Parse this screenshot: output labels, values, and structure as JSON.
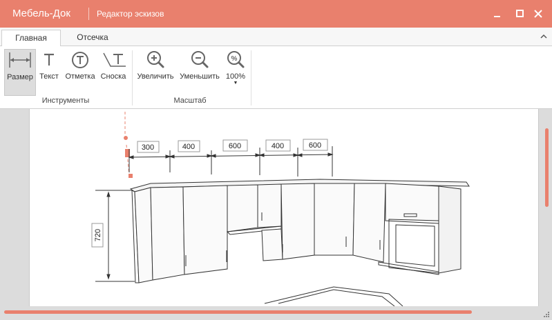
{
  "window": {
    "app_title": "Мебель-Док",
    "doc_title": "Редактор эскизов",
    "accent_color": "#e9806d",
    "controls": [
      "minimize-icon",
      "maximize-icon",
      "close-icon"
    ]
  },
  "tabs": [
    {
      "label": "Главная",
      "active": true
    },
    {
      "label": "Отсечка",
      "active": false
    }
  ],
  "ribbon": {
    "groups": [
      {
        "label": "Инструменты",
        "buttons": [
          {
            "label": "Размер",
            "icon": "dimension-icon",
            "selected": true
          },
          {
            "label": "Текст",
            "icon": "text-icon"
          },
          {
            "label": "Отметка",
            "icon": "mark-icon"
          },
          {
            "label": "Сноска",
            "icon": "leader-note-icon"
          }
        ]
      },
      {
        "label": "Масштаб",
        "buttons": [
          {
            "label": "Увеличить",
            "icon": "zoom-in-icon"
          },
          {
            "label": "Уменьшить",
            "icon": "zoom-out-icon"
          },
          {
            "label": "100%",
            "icon": "zoom-percent-icon",
            "has_dropdown": true
          }
        ]
      }
    ]
  },
  "drawing": {
    "horizontal_dimensions": [
      "300",
      "400",
      "600",
      "400",
      "600"
    ],
    "vertical_dimension": "720"
  }
}
